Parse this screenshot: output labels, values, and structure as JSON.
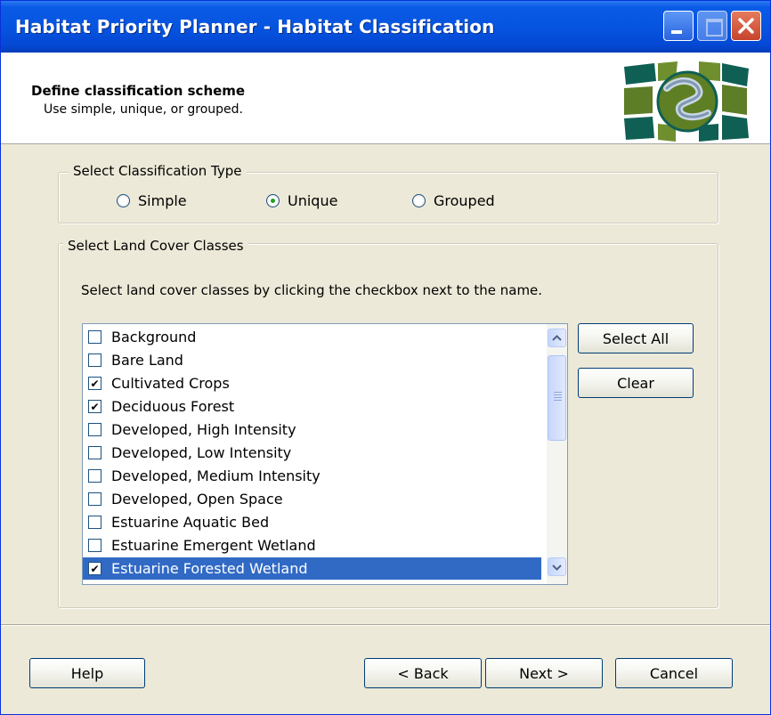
{
  "window": {
    "title": "Habitat Priority Planner - Habitat Classification",
    "colors": {
      "titlebar": "#0654e0",
      "background": "#ece9d8",
      "selection": "#316ac5"
    }
  },
  "header": {
    "title": "Define classification scheme",
    "subtitle": "Use simple, unique, or grouped."
  },
  "classification_type": {
    "legend": "Select Classification Type",
    "options": [
      {
        "label": "Simple",
        "checked": false
      },
      {
        "label": "Unique",
        "checked": true
      },
      {
        "label": "Grouped",
        "checked": false
      }
    ]
  },
  "land_cover": {
    "legend": "Select Land Cover Classes",
    "instruction": "Select land cover classes by clicking the checkbox next to the name.",
    "items": [
      {
        "label": "Background",
        "checked": false,
        "selected": false
      },
      {
        "label": "Bare Land",
        "checked": false,
        "selected": false
      },
      {
        "label": "Cultivated Crops",
        "checked": true,
        "selected": false
      },
      {
        "label": "Deciduous Forest",
        "checked": true,
        "selected": false
      },
      {
        "label": "Developed, High Intensity",
        "checked": false,
        "selected": false
      },
      {
        "label": "Developed, Low Intensity",
        "checked": false,
        "selected": false
      },
      {
        "label": "Developed, Medium Intensity",
        "checked": false,
        "selected": false
      },
      {
        "label": "Developed, Open Space",
        "checked": false,
        "selected": false
      },
      {
        "label": "Estuarine Aquatic Bed",
        "checked": false,
        "selected": false
      },
      {
        "label": "Estuarine Emergent Wetland",
        "checked": false,
        "selected": false
      },
      {
        "label": "Estuarine Forested Wetland",
        "checked": true,
        "selected": true
      }
    ],
    "select_all_label": "Select All",
    "clear_label": "Clear"
  },
  "footer": {
    "help_label": "Help",
    "back_label": "< Back",
    "next_label": "Next >",
    "cancel_label": "Cancel"
  },
  "icons": {
    "minimize": "minimize-icon",
    "maximize": "maximize-icon",
    "close": "close-icon",
    "logo": "habitat-logo-icon",
    "scroll_up": "chevron-up-icon",
    "scroll_down": "chevron-down-icon"
  }
}
